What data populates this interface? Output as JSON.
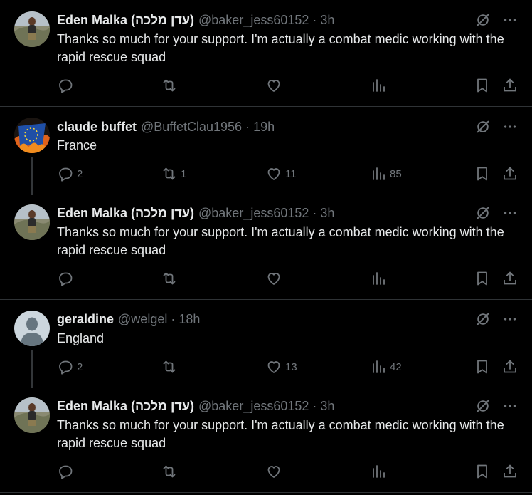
{
  "tweets": [
    {
      "name": "Eden Malka (עדן מלכה)",
      "handle": "@baker_jess60152",
      "separator": "·",
      "time": "3h",
      "text": "Thanks so much for your support. I'm actually a combat medic working with the rapid rescue squad",
      "replies": "",
      "retweets": "",
      "likes": "",
      "views": ""
    },
    {
      "name": "claude buffet",
      "handle": "@BuffetClau1956",
      "separator": "·",
      "time": "19h",
      "text": "France",
      "replies": "2",
      "retweets": "1",
      "likes": "11",
      "views": "85"
    },
    {
      "name": "Eden Malka (עדן מלכה)",
      "handle": "@baker_jess60152",
      "separator": "·",
      "time": "3h",
      "text": "Thanks so much for your support. I'm actually a combat medic working with the rapid rescue squad",
      "replies": "",
      "retweets": "",
      "likes": "",
      "views": ""
    },
    {
      "name": "geraldine",
      "handle": "@welgel",
      "separator": "·",
      "time": "18h",
      "text": "England",
      "replies": "2",
      "retweets": "",
      "likes": "13",
      "views": "42"
    },
    {
      "name": "Eden Malka (עדן מלכה)",
      "handle": "@baker_jess60152",
      "separator": "·",
      "time": "3h",
      "text": "Thanks so much for your support. I'm actually a combat medic working with the rapid rescue squad",
      "replies": "",
      "retweets": "",
      "likes": "",
      "views": ""
    }
  ],
  "icons": {
    "grok": "grok-icon",
    "more": "more-icon",
    "reply": "reply-icon",
    "retweet": "retweet-icon",
    "like": "like-icon",
    "views": "views-icon",
    "bookmark": "bookmark-icon",
    "share": "share-icon"
  },
  "colors": {
    "background": "#000000",
    "text": "#e7e9ea",
    "muted": "#71767b",
    "divider": "#2f3336"
  }
}
